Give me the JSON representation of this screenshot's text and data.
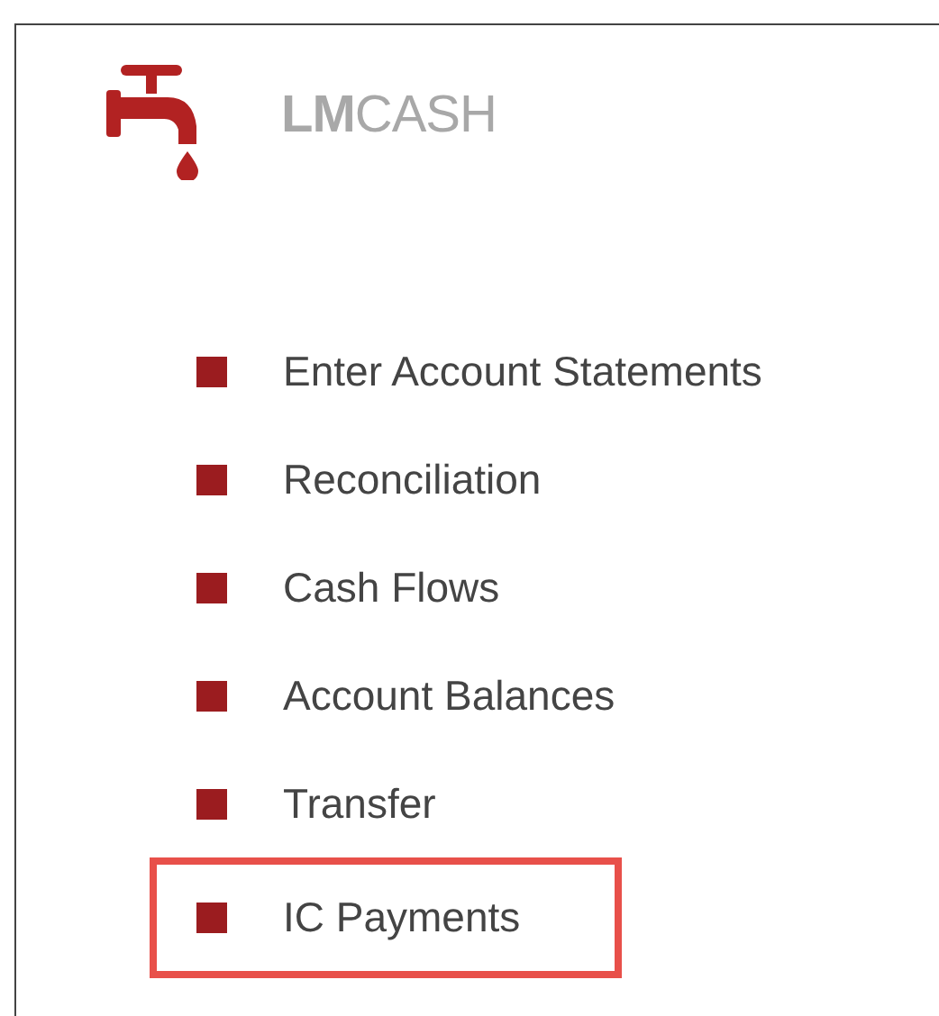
{
  "app": {
    "title": "**LM**CASH"
  },
  "menu": [
    {
      "label": "Enter Account Statements",
      "highlighted": false
    },
    {
      "label": "Reconciliation",
      "highlighted": false
    },
    {
      "label": "Cash Flows",
      "highlighted": false
    },
    {
      "label": "Account Balances",
      "highlighted": false
    },
    {
      "label": "Transfer",
      "highlighted": false
    },
    {
      "label": "IC Payments",
      "highlighted": true
    }
  ]
}
